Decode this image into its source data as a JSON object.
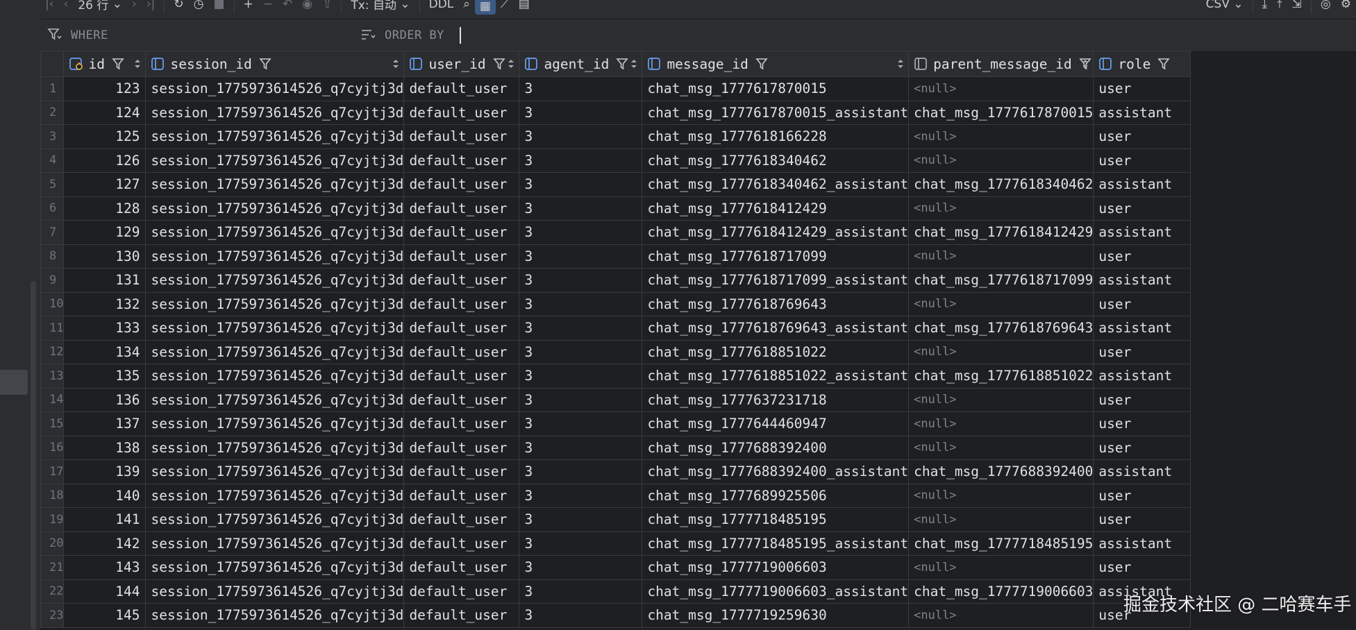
{
  "toolbar": {
    "rows_label": "26 行",
    "tx_label": "Tx: 自动",
    "ddl_label": "DDL",
    "export_format": "CSV"
  },
  "filter": {
    "where_label": "WHERE",
    "order_label": "ORDER BY"
  },
  "columns": [
    {
      "name": "id"
    },
    {
      "name": "session_id"
    },
    {
      "name": "user_id"
    },
    {
      "name": "agent_id"
    },
    {
      "name": "message_id"
    },
    {
      "name": "parent_message_id"
    },
    {
      "name": "role"
    }
  ],
  "rows": [
    {
      "n": "1",
      "id": "123",
      "session": "session_1775973614526_q7cyjtj3d",
      "user": "default_user",
      "agent": "3",
      "msg": "chat_msg_1777617870015",
      "parent": "<null>",
      "role": "user"
    },
    {
      "n": "2",
      "id": "124",
      "session": "session_1775973614526_q7cyjtj3d",
      "user": "default_user",
      "agent": "3",
      "msg": "chat_msg_1777617870015_assistant",
      "parent": "chat_msg_1777617870015",
      "role": "assistant"
    },
    {
      "n": "3",
      "id": "125",
      "session": "session_1775973614526_q7cyjtj3d",
      "user": "default_user",
      "agent": "3",
      "msg": "chat_msg_1777618166228",
      "parent": "<null>",
      "role": "user"
    },
    {
      "n": "4",
      "id": "126",
      "session": "session_1775973614526_q7cyjtj3d",
      "user": "default_user",
      "agent": "3",
      "msg": "chat_msg_1777618340462",
      "parent": "<null>",
      "role": "user"
    },
    {
      "n": "5",
      "id": "127",
      "session": "session_1775973614526_q7cyjtj3d",
      "user": "default_user",
      "agent": "3",
      "msg": "chat_msg_1777618340462_assistant",
      "parent": "chat_msg_1777618340462",
      "role": "assistant"
    },
    {
      "n": "6",
      "id": "128",
      "session": "session_1775973614526_q7cyjtj3d",
      "user": "default_user",
      "agent": "3",
      "msg": "chat_msg_1777618412429",
      "parent": "<null>",
      "role": "user"
    },
    {
      "n": "7",
      "id": "129",
      "session": "session_1775973614526_q7cyjtj3d",
      "user": "default_user",
      "agent": "3",
      "msg": "chat_msg_1777618412429_assistant",
      "parent": "chat_msg_1777618412429",
      "role": "assistant"
    },
    {
      "n": "8",
      "id": "130",
      "session": "session_1775973614526_q7cyjtj3d",
      "user": "default_user",
      "agent": "3",
      "msg": "chat_msg_1777618717099",
      "parent": "<null>",
      "role": "user"
    },
    {
      "n": "9",
      "id": "131",
      "session": "session_1775973614526_q7cyjtj3d",
      "user": "default_user",
      "agent": "3",
      "msg": "chat_msg_1777618717099_assistant",
      "parent": "chat_msg_1777618717099",
      "role": "assistant"
    },
    {
      "n": "10",
      "id": "132",
      "session": "session_1775973614526_q7cyjtj3d",
      "user": "default_user",
      "agent": "3",
      "msg": "chat_msg_1777618769643",
      "parent": "<null>",
      "role": "user"
    },
    {
      "n": "11",
      "id": "133",
      "session": "session_1775973614526_q7cyjtj3d",
      "user": "default_user",
      "agent": "3",
      "msg": "chat_msg_1777618769643_assistant",
      "parent": "chat_msg_1777618769643",
      "role": "assistant"
    },
    {
      "n": "12",
      "id": "134",
      "session": "session_1775973614526_q7cyjtj3d",
      "user": "default_user",
      "agent": "3",
      "msg": "chat_msg_1777618851022",
      "parent": "<null>",
      "role": "user"
    },
    {
      "n": "13",
      "id": "135",
      "session": "session_1775973614526_q7cyjtj3d",
      "user": "default_user",
      "agent": "3",
      "msg": "chat_msg_1777618851022_assistant",
      "parent": "chat_msg_1777618851022",
      "role": "assistant"
    },
    {
      "n": "14",
      "id": "136",
      "session": "session_1775973614526_q7cyjtj3d",
      "user": "default_user",
      "agent": "3",
      "msg": "chat_msg_1777637231718",
      "parent": "<null>",
      "role": "user"
    },
    {
      "n": "15",
      "id": "137",
      "session": "session_1775973614526_q7cyjtj3d",
      "user": "default_user",
      "agent": "3",
      "msg": "chat_msg_1777644460947",
      "parent": "<null>",
      "role": "user"
    },
    {
      "n": "16",
      "id": "138",
      "session": "session_1775973614526_q7cyjtj3d",
      "user": "default_user",
      "agent": "3",
      "msg": "chat_msg_1777688392400",
      "parent": "<null>",
      "role": "user"
    },
    {
      "n": "17",
      "id": "139",
      "session": "session_1775973614526_q7cyjtj3d",
      "user": "default_user",
      "agent": "3",
      "msg": "chat_msg_1777688392400_assistant",
      "parent": "chat_msg_1777688392400",
      "role": "assistant"
    },
    {
      "n": "18",
      "id": "140",
      "session": "session_1775973614526_q7cyjtj3d",
      "user": "default_user",
      "agent": "3",
      "msg": "chat_msg_1777689925506",
      "parent": "<null>",
      "role": "user"
    },
    {
      "n": "19",
      "id": "141",
      "session": "session_1775973614526_q7cyjtj3d",
      "user": "default_user",
      "agent": "3",
      "msg": "chat_msg_1777718485195",
      "parent": "<null>",
      "role": "user"
    },
    {
      "n": "20",
      "id": "142",
      "session": "session_1775973614526_q7cyjtj3d",
      "user": "default_user",
      "agent": "3",
      "msg": "chat_msg_1777718485195_assistant",
      "parent": "chat_msg_1777718485195",
      "role": "assistant"
    },
    {
      "n": "21",
      "id": "143",
      "session": "session_1775973614526_q7cyjtj3d",
      "user": "default_user",
      "agent": "3",
      "msg": "chat_msg_1777719006603",
      "parent": "<null>",
      "role": "user"
    },
    {
      "n": "22",
      "id": "144",
      "session": "session_1775973614526_q7cyjtj3d",
      "user": "default_user",
      "agent": "3",
      "msg": "chat_msg_1777719006603_assistant",
      "parent": "chat_msg_1777719006603",
      "role": "assistant"
    },
    {
      "n": "23",
      "id": "145",
      "session": "session_1775973614526_q7cyjtj3d",
      "user": "default_user",
      "agent": "3",
      "msg": "chat_msg_1777719259630",
      "parent": "<null>",
      "role": "user"
    }
  ],
  "watermark": "掘金技术社区 @ 二哈赛车手",
  "colors": {
    "background": "#1e1f22",
    "panel": "#2b2d30",
    "grid_line": "#393b40",
    "text": "#dfe1e5",
    "null_text": "#7f8389",
    "primary_key_icon": "#e0b347",
    "column_icon": "#6aa0f0",
    "selected_button": "#3d5a85"
  }
}
